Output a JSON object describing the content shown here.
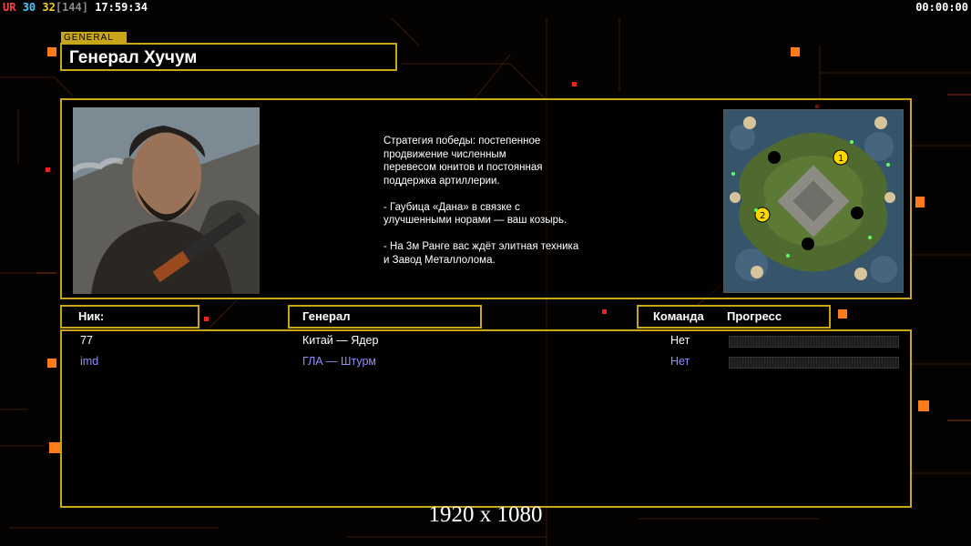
{
  "hud": {
    "ur": "UR",
    "fps_a": "30",
    "fps_b": "32",
    "fps_limit": "[144]",
    "clock": "17:59:34",
    "timer": "00:00:00"
  },
  "section_tag": "GENERAL",
  "general_name": "Генерал Хучум",
  "description": "Стратегия победы: постепенное\nпродвижение численным\nперевесом юнитов и постоянная\nподдержка артиллерии.\n\n- Гаубица «Дана» в связке с\nулучшенными норами — ваш козырь.\n\n- На 3м Ранге вас ждёт элитная техника\nи Завод Металлолома.",
  "minimap": {
    "spawn_1": "1",
    "spawn_2": "2"
  },
  "headers": {
    "nick": "Ник:",
    "general": "Генерал",
    "team": "Команда",
    "progress": "Прогресс"
  },
  "players": [
    {
      "nick": "77",
      "general": "Китай — Ядер",
      "team": "Нет",
      "color": "#ffffff",
      "progress": 0
    },
    {
      "nick": "imd",
      "general": "ГЛА — Штурм",
      "team": "Нет",
      "color": "#8f8fff",
      "progress": 0
    }
  ],
  "resolution": "1920 x 1080",
  "colors": {
    "accent": "#c9a51a",
    "orange": "#ff7a1a"
  }
}
